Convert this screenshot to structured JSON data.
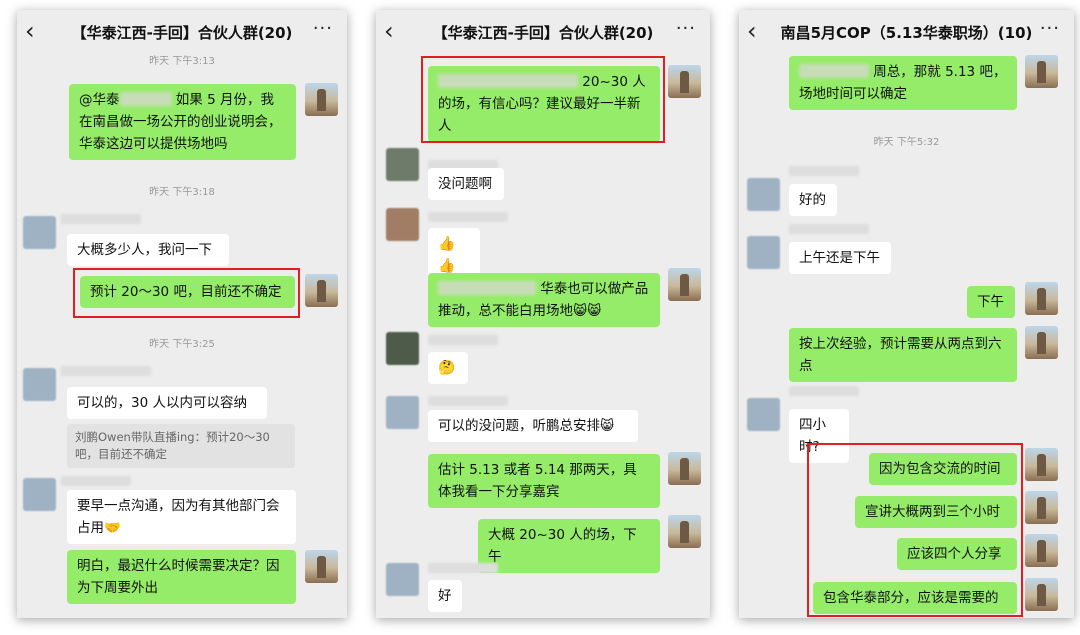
{
  "colors": {
    "accent_green": "#95ec69",
    "highlight_red": "#e02020",
    "background": "#ededed"
  },
  "common": {
    "back_icon": "‹",
    "more_icon": "···"
  },
  "panel1": {
    "title": "【华泰江西-手回】合伙人群(20)",
    "ts1": "昨天 下午3:13",
    "m1_at": "@华泰",
    "m1_text": "如果 5 月份，我在南昌做一场公开的创业说明会，华泰这边可以提供场地吗",
    "ts2": "昨天 下午3:18",
    "m2": "大概多少人，我问一下",
    "m3": "预计 20～30 吧，目前还不确定",
    "ts3": "昨天 下午3:25",
    "m4": "可以的，30 人以内可以容纳",
    "quote": "刘鹏Owen带队直播ing：预计20～30吧，目前还不确定",
    "m5": "要早一点沟通，因为有其他部门会占用🤝",
    "m6": "明白，最迟什么时候需要决定？因为下周要外出"
  },
  "panel2": {
    "title": "【华泰江西-手回】合伙人群(20)",
    "m1": "20~30 人的场，有信心吗？建议最好一半新人",
    "m2": "没问题啊",
    "m3": "👍👍",
    "m4": "华泰也可以做产品推动，总不能白用场地😸😸",
    "m5": "🤔",
    "m6": "可以的没问题，听鹏总安排😸",
    "m7": "估计 5.13 或者 5.14 那两天，具体我看一下分享嘉宾",
    "m8": "大概 20~30 人的场，下午",
    "m9": "好"
  },
  "panel3": {
    "title": "南昌5月COP（5.13华泰职场）(10)",
    "m1": "周总，那就 5.13 吧，场地时间可以确定",
    "ts1": "昨天 下午5:32",
    "m2": "好的",
    "m3": "上午还是下午",
    "m4": "下午",
    "m5": "按上次经验，预计需要从两点到六点",
    "m6": "四小时?",
    "m7": "因为包含交流的时间",
    "m8": "宣讲大概两到三个小时",
    "m9": "应该四个人分享",
    "m10": "包含华泰部分，应该是需要的"
  }
}
